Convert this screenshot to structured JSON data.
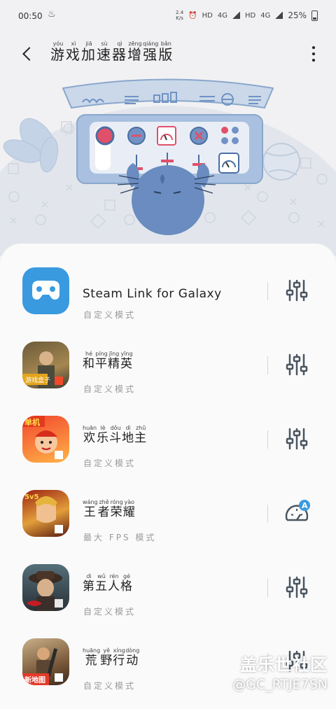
{
  "status_bar": {
    "time": "00:50",
    "extra": "♨",
    "net_speed_top": "2.4",
    "net_speed_bottom": "K/s",
    "hd1": "HD",
    "lte1": "4G",
    "hd2": "HD",
    "lte2": "4G",
    "battery": "25%"
  },
  "header": {
    "title_chars": [
      {
        "c": "游",
        "p": "yóu"
      },
      {
        "c": "戏",
        "p": "xì"
      },
      {
        "c": "加",
        "p": "jiā"
      },
      {
        "c": "速",
        "p": "sù"
      },
      {
        "c": "器",
        "p": "qì"
      },
      {
        "c": "增",
        "p": "zēng"
      },
      {
        "c": "强",
        "p": "qiáng"
      },
      {
        "c": "版",
        "p": "bǎn"
      }
    ]
  },
  "apps": [
    {
      "name": "Steam Link for Galaxy",
      "latin": true,
      "mode": "自定义模式",
      "action": "sliders-icon"
    },
    {
      "name_chars": [
        {
          "c": "和",
          "p": "hé"
        },
        {
          "c": "平",
          "p": "píng"
        },
        {
          "c": "精",
          "p": "jīng"
        },
        {
          "c": "英",
          "p": "yīng"
        }
      ],
      "mode": "自定义模式",
      "action": "sliders-icon"
    },
    {
      "name_chars": [
        {
          "c": "欢",
          "p": "huān"
        },
        {
          "c": "乐",
          "p": "lè"
        },
        {
          "c": "斗",
          "p": "dǒu"
        },
        {
          "c": "地",
          "p": "dì"
        },
        {
          "c": "主",
          "p": "zhǔ"
        }
      ],
      "mode": "自定义模式",
      "action": "sliders-icon"
    },
    {
      "name_chars": [
        {
          "c": "王",
          "p": "wáng"
        },
        {
          "c": "者",
          "p": "zhě"
        },
        {
          "c": "荣",
          "p": "róng"
        },
        {
          "c": "耀",
          "p": "yào"
        }
      ],
      "mode": "最大 FPS 模式",
      "action": "speedometer-auto-icon"
    },
    {
      "name_chars": [
        {
          "c": "第",
          "p": "dì"
        },
        {
          "c": "五",
          "p": "wǔ"
        },
        {
          "c": "人",
          "p": "rén"
        },
        {
          "c": "格",
          "p": "gé"
        }
      ],
      "mode": "自定义模式",
      "action": "sliders-icon"
    },
    {
      "name_chars": [
        {
          "c": "荒",
          "p": "huāng"
        },
        {
          "c": "野",
          "p": "yě"
        },
        {
          "c": "行",
          "p": "xíng"
        },
        {
          "c": "动",
          "p": "dòng"
        }
      ],
      "mode": "自定义模式",
      "action": "sliders-icon"
    }
  ],
  "app_badges": {
    "peace_elite": "游戏盒子",
    "doudizhu": "单机",
    "honor": "5v5",
    "knives": "新地图"
  },
  "watermark": {
    "brand": "盖乐世社区",
    "user": "@GC_RTJE7SN"
  },
  "colors": {
    "accent_blue": "#3a9ae0",
    "hero_blue": "#5f8fc6",
    "icon_gray": "#4a5560"
  }
}
